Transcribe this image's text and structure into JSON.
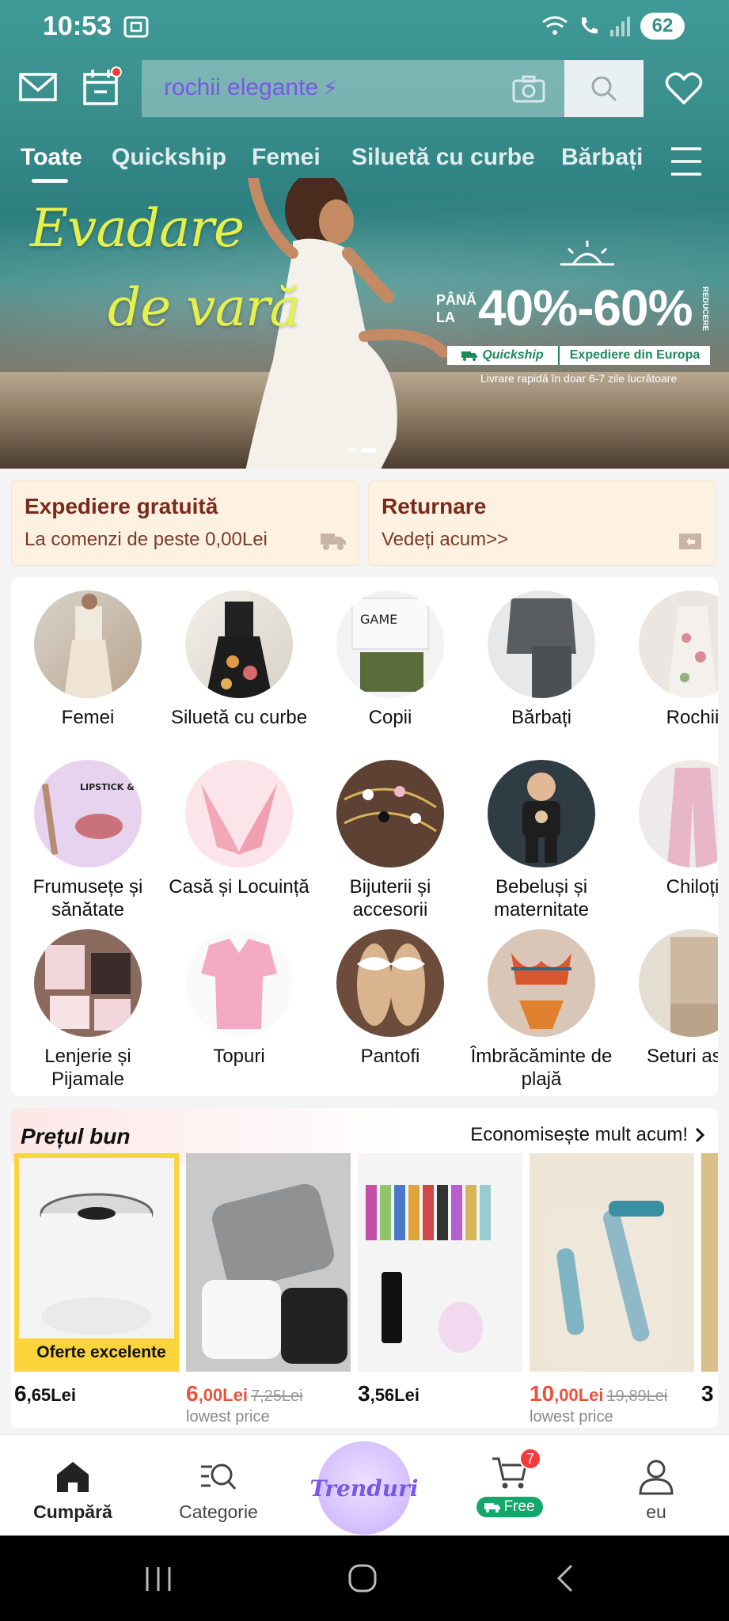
{
  "status_bar": {
    "time": "10:53",
    "battery": "62"
  },
  "search": {
    "query": "rochii elegante"
  },
  "tabs": [
    "Toate",
    "Quickship",
    "Femei",
    "Siluetă cu curbe",
    "Bărbați"
  ],
  "banner": {
    "title_line1": "Evadare",
    "title_line2": "de vară",
    "pana_la": "PÂNĂ LA",
    "discount": "40%-60%",
    "reducere": "REDUCERE",
    "quickship": "Quickship",
    "expediere": "Expediere din Europa",
    "subtitle": "Livrare rapidă în doar 6-7 zile lucrătoare"
  },
  "info_cards": [
    {
      "title": "Expediere gratuită",
      "subtitle": "La comenzi de peste 0,00Lei"
    },
    {
      "title": "Returnare",
      "subtitle": "Vedeți acum>>"
    }
  ],
  "categories": [
    {
      "label": "Femei"
    },
    {
      "label": "Siluetă cu curbe"
    },
    {
      "label": "Copii"
    },
    {
      "label": "Bărbați"
    },
    {
      "label": "Rochii"
    },
    {
      "label": "Frumusețe și sănătate"
    },
    {
      "label": "Casă și Locuință"
    },
    {
      "label": "Bijuterii și accesorii"
    },
    {
      "label": "Bebeluși și maternitate"
    },
    {
      "label": "Chiloți"
    },
    {
      "label": "Lenjerie și Pijamale"
    },
    {
      "label": "Topuri"
    },
    {
      "label": "Pantofi"
    },
    {
      "label": "Îmbrăcăminte de plajă"
    },
    {
      "label": "Seturi asor"
    }
  ],
  "deals": {
    "title": "Prețul bun",
    "link": "Economisește mult acum!",
    "products": [
      {
        "price_int": "6",
        "price_dec": ",65Lei",
        "old_price": "",
        "note": "",
        "badge": "Oferte excelente"
      },
      {
        "price_int": "6",
        "price_dec": ",00Lei",
        "old_price": "7,25Lei",
        "note": "lowest price",
        "badge": ""
      },
      {
        "price_int": "3",
        "price_dec": ",56Lei",
        "old_price": "",
        "note": "",
        "badge": ""
      },
      {
        "price_int": "10",
        "price_dec": ",00Lei",
        "old_price": "19,89Lei",
        "note": "lowest price",
        "badge": ""
      },
      {
        "price_int": "3",
        "price_dec": "",
        "old_price": "",
        "note": "",
        "badge": ""
      }
    ]
  },
  "bottom_nav": {
    "shop": "Cumpără",
    "category": "Categorie",
    "trending": "Trenduri",
    "cart_count": "7",
    "cart_free": "Free",
    "me": "eu"
  }
}
